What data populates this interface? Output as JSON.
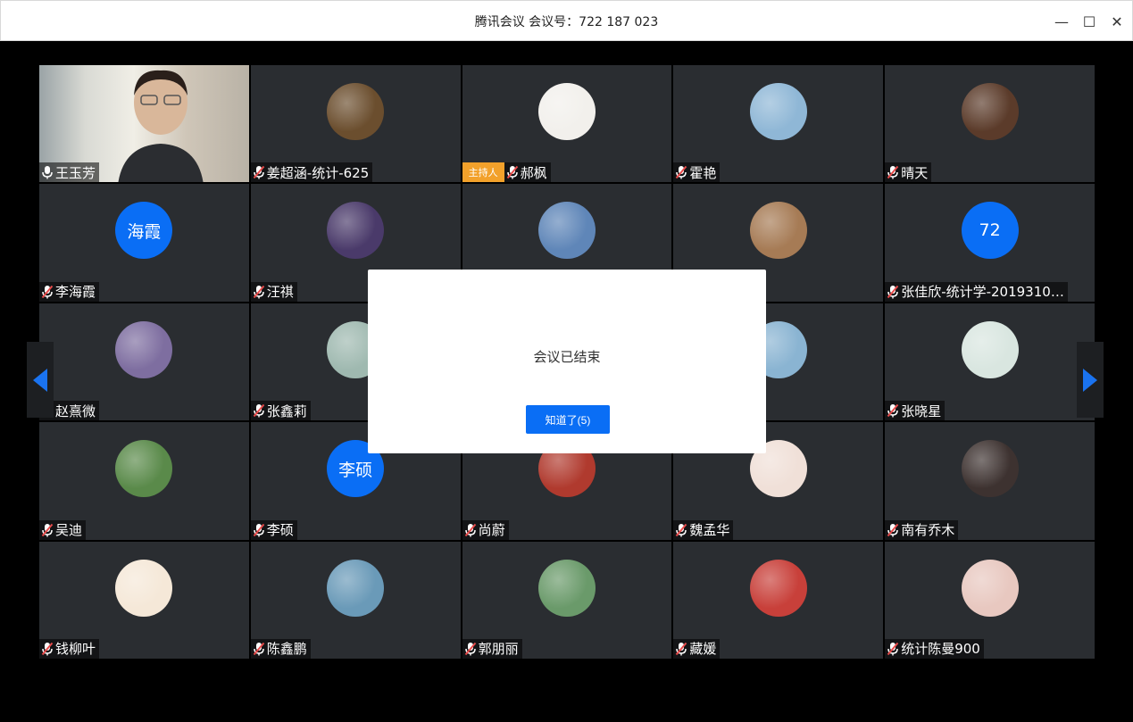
{
  "window": {
    "title": "腾讯会议 会议号：722 187 023",
    "minimize": "—",
    "maximize": "☐",
    "close": "✕"
  },
  "participants": [
    {
      "name": "王玉芳",
      "mic": "on",
      "video": true
    },
    {
      "name": "姜超涵-统计-625",
      "mic": "muted",
      "avatar_color": "#6b4e2e"
    },
    {
      "name": "郝枫",
      "mic": "muted",
      "host_badge": "主持人",
      "avatar_color": "#f2f0ec"
    },
    {
      "name": "霍艳",
      "mic": "muted",
      "avatar_color": "#8fb7d6"
    },
    {
      "name": "晴天",
      "mic": "muted",
      "avatar_color": "#5b3b2a"
    },
    {
      "name": "李海霞",
      "mic": "muted",
      "avatar_text": "海霞"
    },
    {
      "name": "汪祺",
      "mic": "muted",
      "avatar_color": "#4a3a6a"
    },
    {
      "name": "",
      "mic": "muted",
      "avatar_color": "#5f86b8",
      "hidden_name": true
    },
    {
      "name": "",
      "mic": "muted",
      "avatar_color": "#a67b55",
      "hidden_name": true
    },
    {
      "name": "张佳欣-统计学-2019310…",
      "mic": "muted",
      "avatar_text": "72"
    },
    {
      "name": "赵熹微",
      "mic": "muted",
      "avatar_color": "#7e6ea0"
    },
    {
      "name": "张鑫莉",
      "mic": "muted",
      "avatar_color": "#9fb9b0"
    },
    {
      "name": "",
      "mic": "muted",
      "avatar_color": "#cfd9dc",
      "hidden_name": true
    },
    {
      "name": "",
      "mic": "muted",
      "avatar_color": "#8ab4d2",
      "hidden_name": true
    },
    {
      "name": "张晓星",
      "mic": "muted",
      "avatar_color": "#d9e6e0"
    },
    {
      "name": "吴迪",
      "mic": "muted",
      "avatar_color": "#5a8a4a"
    },
    {
      "name": "李硕",
      "mic": "muted",
      "avatar_text": "李硕"
    },
    {
      "name": "尚蔚",
      "mic": "muted",
      "avatar_color": "#b03a2e"
    },
    {
      "name": "魏孟华",
      "mic": "muted",
      "avatar_color": "#f0e0d8"
    },
    {
      "name": "南有乔木",
      "mic": "muted",
      "avatar_color": "#3d3230"
    },
    {
      "name": "钱柳叶",
      "mic": "muted",
      "avatar_color": "#f5e8d8"
    },
    {
      "name": "陈鑫鹏",
      "mic": "muted",
      "avatar_color": "#6a9ab8"
    },
    {
      "name": "郭朋丽",
      "mic": "muted",
      "avatar_color": "#6a9a6a"
    },
    {
      "name": "藏媛",
      "mic": "muted",
      "avatar_color": "#c8403a"
    },
    {
      "name": "统计陈曼900",
      "mic": "muted",
      "avatar_color": "#e8c8c0"
    }
  ],
  "dialog": {
    "message": "会议已结束",
    "button": "知道了(5)"
  },
  "colors": {
    "accent": "#0a6ef5",
    "host_badge": "#f2a12b",
    "tile_bg": "#2a2d31",
    "muted_mic": "#e84b4b"
  },
  "icons": {
    "mic_on": "microphone-icon",
    "mic_muted": "microphone-muted-icon",
    "prev_page": "caret-left-icon",
    "next_page": "caret-right-icon"
  }
}
